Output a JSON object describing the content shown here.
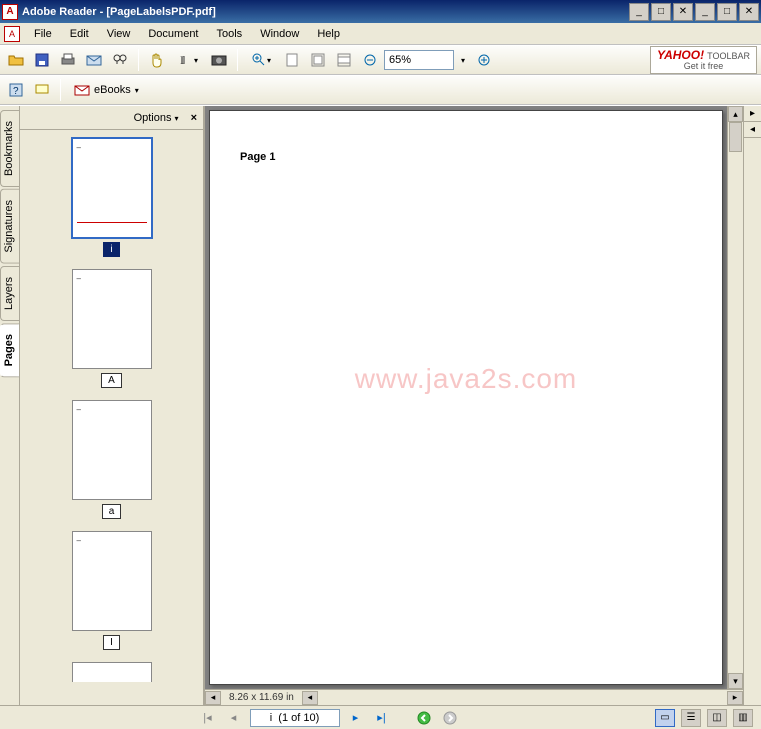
{
  "titlebar": {
    "title": "Adobe Reader - [PageLabelsPDF.pdf]"
  },
  "menu": {
    "file": "File",
    "edit": "Edit",
    "view": "View",
    "document": "Document",
    "tools": "Tools",
    "window": "Window",
    "help": "Help"
  },
  "toolbar1": {
    "open": "open-icon",
    "save": "save-icon",
    "print": "print-icon",
    "email": "email-icon",
    "search": "search-icon",
    "hand": "hand-icon",
    "select": "select-text-icon",
    "snapshot": "snapshot-icon",
    "zoomin": "zoom-in-icon",
    "actual": "actual-size-icon",
    "fitpage": "fit-page-icon",
    "fitwidth": "fit-width-icon",
    "zoomout": "zoom-out-icon",
    "zoom_value": "65%",
    "zoomplus": "zoom-plus-icon"
  },
  "yahoo": {
    "brand": "YAHOO!",
    "sub": "TOOLBAR",
    "cta": "Get it free"
  },
  "toolbar2": {
    "t1": "tool1-icon",
    "t2": "tool2-icon",
    "t3": "tool3-icon",
    "ebooks_label": "eBooks"
  },
  "sidetabs": {
    "bookmarks": "Bookmarks",
    "signatures": "Signatures",
    "layers": "Layers",
    "pages": "Pages"
  },
  "pages_panel": {
    "options": "Options",
    "close": "×",
    "thumbs": [
      {
        "label": "i",
        "selected": true,
        "redline": true
      },
      {
        "label": "A",
        "selected": false,
        "redline": false
      },
      {
        "label": "a",
        "selected": false,
        "redline": false
      },
      {
        "label": "I",
        "selected": false,
        "redline": false
      }
    ]
  },
  "document": {
    "page_text": "Page 1",
    "watermark": "www.java2s.com",
    "dimensions": "8.26 x 11.69 in"
  },
  "statusbar": {
    "page_display": "i  (1 of 10)"
  },
  "colors": {
    "titlebar": "#0a246a",
    "accent": "#316ac5",
    "panel": "#ece9d8"
  }
}
